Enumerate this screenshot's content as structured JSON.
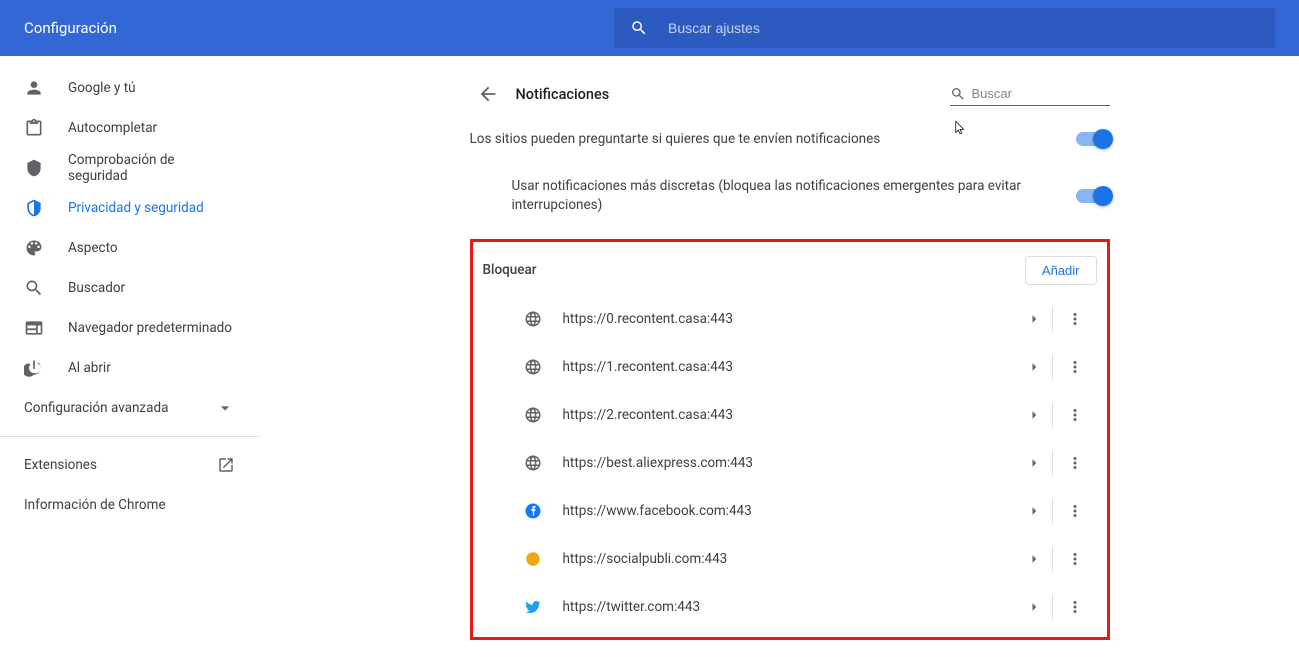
{
  "header": {
    "title": "Configuración",
    "search_placeholder": "Buscar ajustes"
  },
  "sidebar": {
    "items": [
      {
        "label": "Google y tú"
      },
      {
        "label": "Autocompletar"
      },
      {
        "label": "Comprobación de seguridad"
      },
      {
        "label": "Privacidad y seguridad"
      },
      {
        "label": "Aspecto"
      },
      {
        "label": "Buscador"
      },
      {
        "label": "Navegador predeterminado"
      },
      {
        "label": "Al abrir"
      }
    ],
    "advanced_label": "Configuración avanzada",
    "extensions_label": "Extensiones",
    "about_label": "Información de Chrome"
  },
  "content": {
    "page_title": "Notificaciones",
    "search_placeholder": "Buscar",
    "ask_label": "Los sitios pueden preguntarte si quieres que te envíen notificaciones",
    "quiet_label": "Usar notificaciones más discretas (bloquea las notificaciones emergentes para evitar interrupciones)",
    "block_title": "Bloquear",
    "add_label": "Añadir",
    "blocked_sites": [
      {
        "icon": "globe",
        "url": "https://0.recontent.casa:443"
      },
      {
        "icon": "globe",
        "url": "https://1.recontent.casa:443"
      },
      {
        "icon": "globe",
        "url": "https://2.recontent.casa:443"
      },
      {
        "icon": "globe",
        "url": "https://best.aliexpress.com:443"
      },
      {
        "icon": "facebook",
        "url": "https://www.facebook.com:443"
      },
      {
        "icon": "orange",
        "url": "https://socialpubli.com:443"
      },
      {
        "icon": "twitter",
        "url": "https://twitter.com:443"
      }
    ]
  }
}
